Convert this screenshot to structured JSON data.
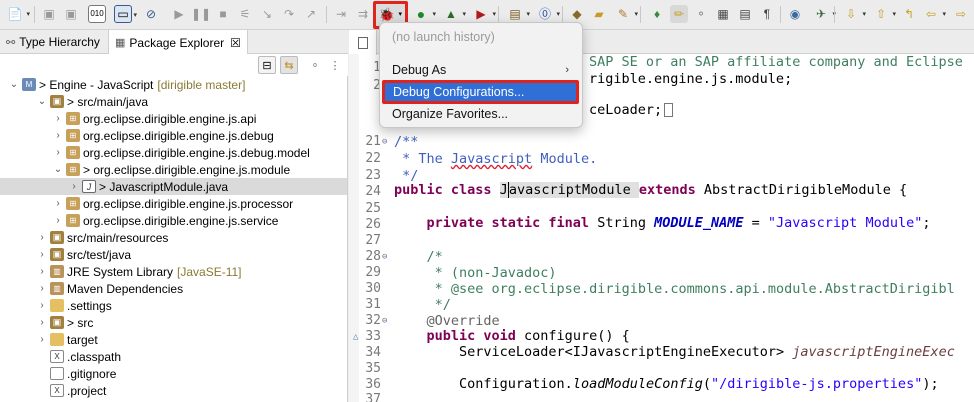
{
  "toolbar": {
    "icons": [
      "new-icon",
      "save-icon",
      "save-all-icon",
      "binary-icon",
      "terminal-icon",
      "skip-breakpoints-icon",
      "resume-icon",
      "suspend-icon",
      "terminate-icon",
      "disconnect-icon",
      "step-into-icon",
      "step-over-icon",
      "step-return-icon",
      "drop-to-frame-icon",
      "use-step-filters-icon",
      "debug-icon",
      "run-icon",
      "coverage-icon",
      "external-tools-icon",
      "new-java-project-icon",
      "new-package-icon",
      "new-class-icon",
      "open-type-icon",
      "open-task-icon",
      "search-icon",
      "highlight-icon",
      "mark-occurrences-icon",
      "block-selection-icon",
      "show-whitespace-icon",
      "globe-icon",
      "next-annotation-icon",
      "prev-annotation-icon",
      "back-icon",
      "forward-icon"
    ]
  },
  "views": {
    "tab_type_hierarchy": "Type Hierarchy",
    "tab_package_explorer": "Package Explorer",
    "close_glyph": "☒"
  },
  "tree": [
    {
      "label": "> Engine - JavaScript",
      "decor": "[dirigible master]"
    },
    {
      "label": "> src/main/java",
      "decor": ""
    },
    {
      "label": "org.eclipse.dirigible.engine.js.api",
      "decor": ""
    },
    {
      "label": "org.eclipse.dirigible.engine.js.debug",
      "decor": ""
    },
    {
      "label": "org.eclipse.dirigible.engine.js.debug.model",
      "decor": ""
    },
    {
      "label": "> org.eclipse.dirigible.engine.js.module",
      "decor": ""
    },
    {
      "label": "> JavascriptModule.java",
      "decor": ""
    },
    {
      "label": "org.eclipse.dirigible.engine.js.processor",
      "decor": ""
    },
    {
      "label": "org.eclipse.dirigible.engine.js.service",
      "decor": ""
    },
    {
      "label": "src/main/resources",
      "decor": ""
    },
    {
      "label": "src/test/java",
      "decor": ""
    },
    {
      "label": "JRE System Library",
      "decor": "[JavaSE-11]"
    },
    {
      "label": "Maven Dependencies",
      "decor": ""
    },
    {
      "label": ".settings",
      "decor": ""
    },
    {
      "label": "> src",
      "decor": ""
    },
    {
      "label": "target",
      "decor": ""
    },
    {
      "label": ".classpath",
      "decor": ""
    },
    {
      "label": ".gitignore",
      "decor": ""
    },
    {
      "label": ".project",
      "decor": ""
    }
  ],
  "menu": {
    "no_history": "(no launch history)",
    "debug_as": "Debug As",
    "debug_configurations": "Debug Configurations...",
    "organize_favorites": "Organize Favorites..."
  },
  "editor": {
    "line_numbers": [
      "1",
      "2",
      "",
      "",
      "",
      "21",
      "22",
      "23",
      "24",
      "25",
      "26",
      "27",
      "28",
      "29",
      "30",
      "31",
      "32",
      "33",
      "34",
      "35",
      "36",
      "37"
    ],
    "line1_tail": "SAP SE or an SAP affiliate company and Eclipse",
    "line2_tail": "rigible.engine.js.module;",
    "line_import_tail": "ceLoader;",
    "l21": "/**",
    "l22_a": " * The ",
    "l22_b": "Javascript",
    "l22_c": " Module.",
    "l23": " */",
    "l24_kw": "public class ",
    "l24_cls_a": "J",
    "l24_cls_b": "avascriptModule ",
    "l24_kw2": "extends ",
    "l24_rest": "AbstractDirigibleModule {",
    "l26_kw": "    private static final ",
    "l26_type": "String ",
    "l26_field": "MODULE_NAME",
    "l26_eq": " = ",
    "l26_str": "\"Javascript Module\"",
    "l26_end": ";",
    "l28": "    /*",
    "l29": "     * (non-Javadoc)",
    "l30": "     * @see org.eclipse.dirigible.commons.api.module.AbstractDirigibl",
    "l31": "     */",
    "l32": "    @Override",
    "l33_kw": "    public void ",
    "l33_rest": "configure() {",
    "l34_a": "        ServiceLoader<IJavascriptEngineExecutor> ",
    "l34_b": "javascriptEngineExec",
    "l36_a": "        Configuration.",
    "l36_b": "loadModuleConfig",
    "l36_c": "(",
    "l36_str": "\"/dirigible-js.properties\"",
    "l36_d": ");"
  }
}
